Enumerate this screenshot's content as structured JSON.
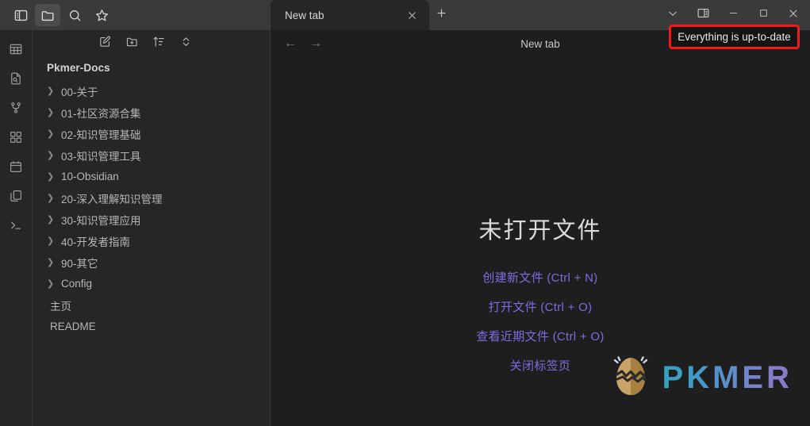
{
  "window": {
    "titlebar_controls": [
      {
        "name": "chevron-down",
        "glyph": "∨"
      },
      {
        "name": "toggle-right-sidebar",
        "glyph": ""
      },
      {
        "name": "minimize",
        "glyph": "─"
      },
      {
        "name": "maximize",
        "glyph": "□"
      },
      {
        "name": "close",
        "glyph": "✕"
      }
    ]
  },
  "left_topbar": {
    "buttons": [
      {
        "icon": "sidebar-toggle-icon",
        "label": "Toggle sidebar",
        "active": false
      },
      {
        "icon": "folder-icon",
        "label": "Files",
        "active": true
      },
      {
        "icon": "search-icon",
        "label": "Search",
        "active": false
      },
      {
        "icon": "star-icon",
        "label": "Bookmarks",
        "active": false
      }
    ]
  },
  "rail": {
    "items": [
      {
        "icon": "table-icon",
        "label": "Table"
      },
      {
        "icon": "file-search-icon",
        "label": "File search"
      },
      {
        "icon": "git-branch-icon",
        "label": "Source control"
      },
      {
        "icon": "dashboard-icon",
        "label": "Dashboard"
      },
      {
        "icon": "calendar-icon",
        "label": "Calendar"
      },
      {
        "icon": "copy-files-icon",
        "label": "Templates"
      },
      {
        "icon": "terminal-icon",
        "label": "Terminal"
      }
    ]
  },
  "file_tree": {
    "toolbar": [
      {
        "icon": "new-note-icon",
        "label": "New note"
      },
      {
        "icon": "new-folder-icon",
        "label": "New folder"
      },
      {
        "icon": "sort-icon",
        "label": "Change sort order"
      },
      {
        "icon": "collapse-icon",
        "label": "Collapse all"
      }
    ],
    "vault_name": "Pkmer-Docs",
    "items": [
      {
        "label": "00-关于",
        "type": "folder"
      },
      {
        "label": "01-社区资源合集",
        "type": "folder"
      },
      {
        "label": "02-知识管理基础",
        "type": "folder"
      },
      {
        "label": "03-知识管理工具",
        "type": "folder"
      },
      {
        "label": "10-Obsidian",
        "type": "folder"
      },
      {
        "label": "20-深入理解知识管理",
        "type": "folder"
      },
      {
        "label": "30-知识管理应用",
        "type": "folder"
      },
      {
        "label": "40-开发者指南",
        "type": "folder"
      },
      {
        "label": "90-其它",
        "type": "folder"
      },
      {
        "label": "Config",
        "type": "folder"
      },
      {
        "label": "主页",
        "type": "file"
      },
      {
        "label": "README",
        "type": "file"
      }
    ]
  },
  "tabs": {
    "items": [
      {
        "title": "New tab",
        "active": true
      }
    ],
    "new_tab_label": "+"
  },
  "content": {
    "nav_back": "←",
    "nav_forward": "→",
    "header_title": "New tab",
    "empty_title": "未打开文件",
    "actions": [
      "创建新文件 (Ctrl + N)",
      "打开文件 (Ctrl + O)",
      "查看近期文件 (Ctrl + O)",
      "关闭标签页"
    ],
    "logo_text": "PKMER"
  },
  "tooltip": {
    "text": "Everything is up-to-date",
    "highlight_color": "#f01a1a"
  },
  "colors": {
    "titlebar_bg": "#3a3a3a",
    "sidebar_bg": "#262626",
    "editor_bg": "#1e1e1e",
    "accent_link": "#7d6ce0",
    "logo_gradient_start": "#33a3bd",
    "logo_gradient_end": "#8b7ac9"
  }
}
